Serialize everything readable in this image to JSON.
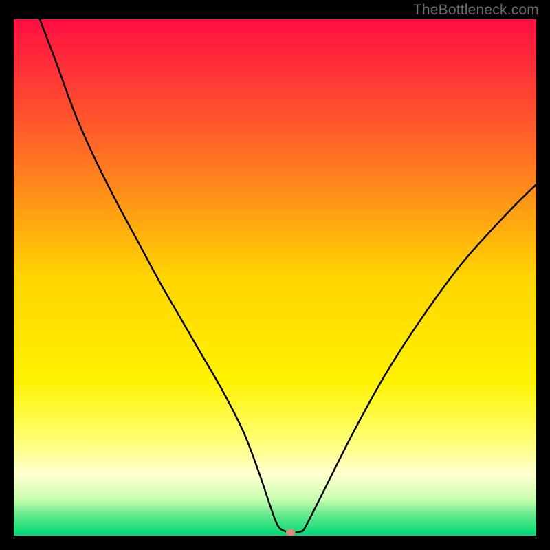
{
  "watermark": "TheBottleneck.com",
  "chart_data": {
    "type": "line",
    "title": "",
    "xlabel": "",
    "ylabel": "",
    "xlim": [
      0,
      100
    ],
    "ylim": [
      0,
      100
    ],
    "grid": false,
    "legend": false,
    "background_gradient": {
      "stops": [
        {
          "offset": 0.0,
          "color": "#ff0e43"
        },
        {
          "offset": 0.25,
          "color": "#ff6a26"
        },
        {
          "offset": 0.5,
          "color": "#ffd500"
        },
        {
          "offset": 0.7,
          "color": "#fff200"
        },
        {
          "offset": 0.82,
          "color": "#ffff7a"
        },
        {
          "offset": 0.88,
          "color": "#ffffd0"
        },
        {
          "offset": 0.93,
          "color": "#c9ffb0"
        },
        {
          "offset": 0.965,
          "color": "#55e787"
        },
        {
          "offset": 1.0,
          "color": "#00d977"
        }
      ]
    },
    "series": [
      {
        "name": "bottleneck-curve",
        "color": "#000000",
        "stroke_width": 2.5,
        "x": [
          5,
          8,
          12,
          16,
          20,
          24,
          28,
          32,
          36,
          40,
          44,
          47,
          49,
          50.5,
          52,
          53.5,
          55,
          56,
          60,
          65,
          71,
          78,
          86,
          95,
          100
        ],
        "y": [
          100,
          92,
          81,
          72,
          64,
          56.5,
          49,
          42,
          35,
          28,
          20,
          12,
          6,
          2,
          0.8,
          0.6,
          0.8,
          2,
          10,
          20,
          31,
          42,
          53,
          63,
          68
        ]
      }
    ],
    "marker": {
      "name": "optimal-point",
      "x": 53,
      "y": 0.6,
      "color": "#d98d77",
      "rx": 7,
      "ry": 5
    }
  }
}
